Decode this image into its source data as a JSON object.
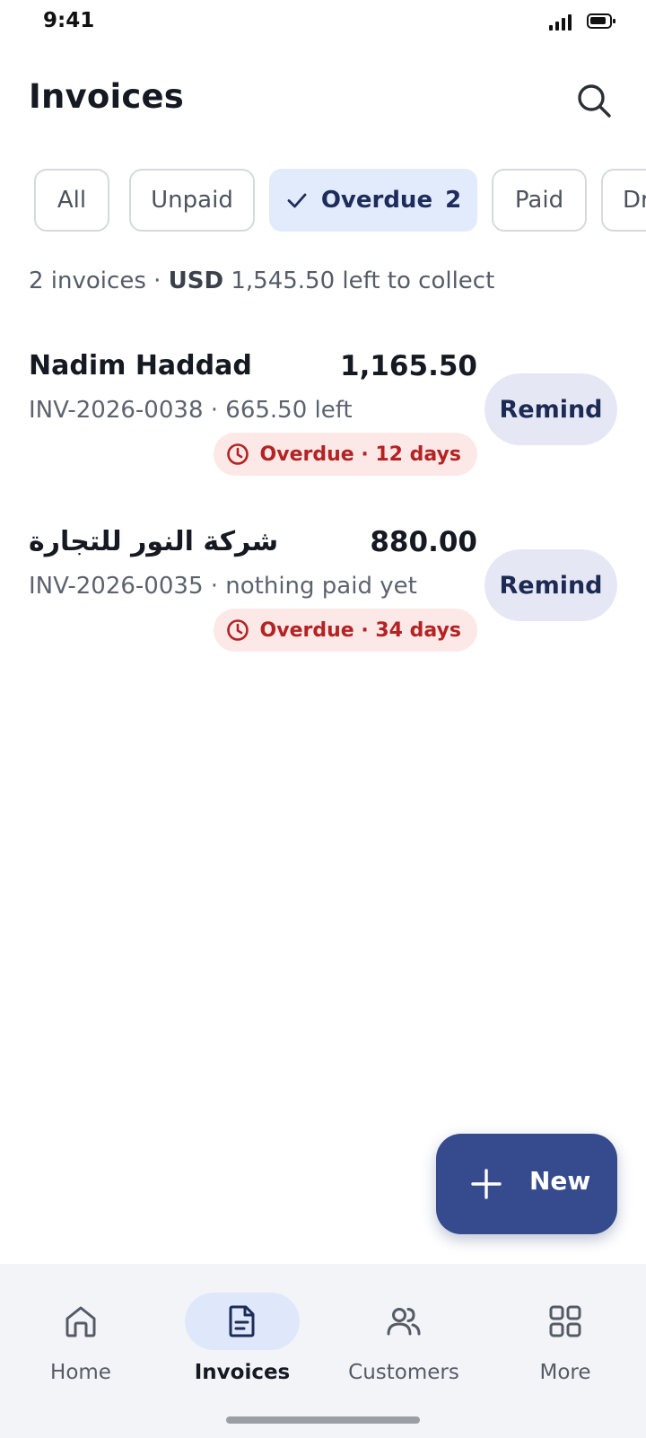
{
  "status_bar": {
    "time": "9:41"
  },
  "header": {
    "title": "Invoices"
  },
  "filters": [
    {
      "label": "All",
      "count": ""
    },
    {
      "label": "Unpaid",
      "count": ""
    },
    {
      "label": "Overdue",
      "count": "2",
      "selected": true
    },
    {
      "label": "Paid",
      "count": ""
    },
    {
      "label": "Draft",
      "count": ""
    }
  ],
  "summary": {
    "count_text": "2 invoices · ",
    "currency": "USD",
    "amount_text": " 1,545.50 left to collect"
  },
  "invoices": [
    {
      "customer": "Nadim Haddad",
      "amount": "1,165.50",
      "meta": "INV-2026-0038 · 665.50 left",
      "status": "Overdue · 12 days",
      "action": "Remind"
    },
    {
      "customer": "شركة النور للتجارة",
      "amount": "880.00",
      "meta": "INV-2026-0035 · nothing paid yet",
      "status": "Overdue · 34 days",
      "action": "Remind"
    }
  ],
  "fab": {
    "label": "New",
    "icon": "plus-icon"
  },
  "nav": [
    {
      "label": "Home",
      "icon": "home-icon"
    },
    {
      "label": "Invoices",
      "icon": "document-icon",
      "active": true
    },
    {
      "label": "Customers",
      "icon": "users-icon"
    },
    {
      "label": "More",
      "icon": "grid-icon"
    }
  ],
  "colors": {
    "primary": "#364b8e",
    "chip_active_bg": "#e2ebfb",
    "overdue_text": "#b42323",
    "overdue_bg": "#fde8e8"
  }
}
